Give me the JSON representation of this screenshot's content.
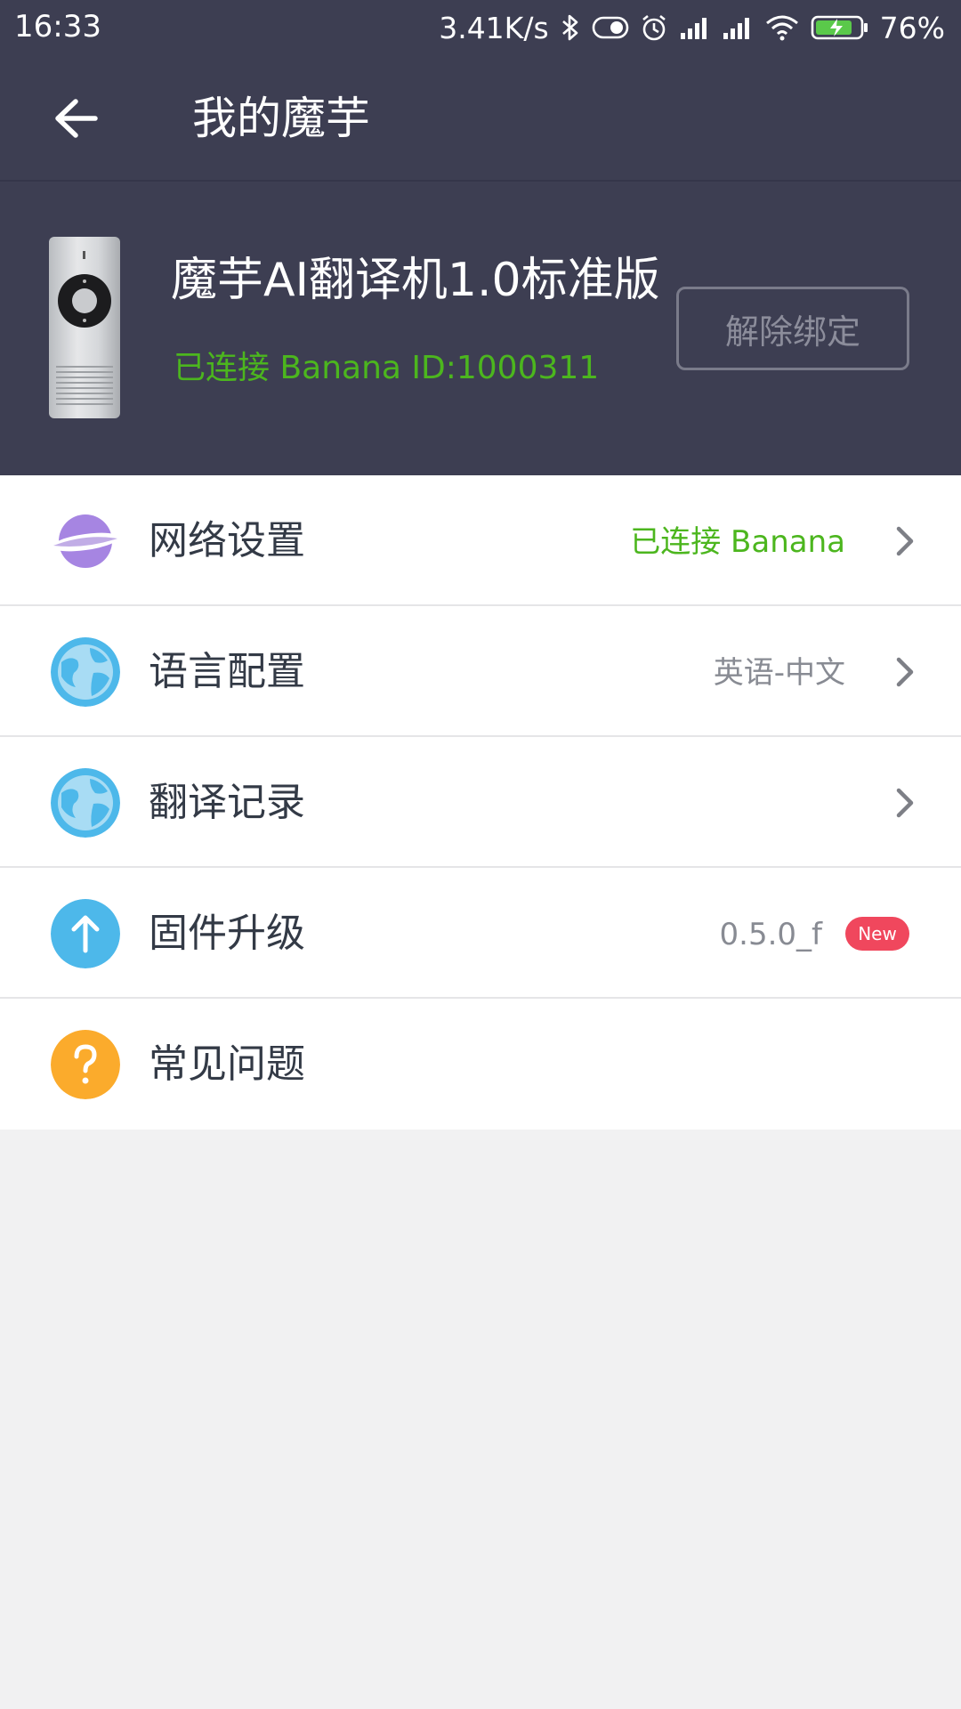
{
  "status_bar": {
    "time": "16:33",
    "net_speed": "3.41K/s",
    "battery": "76%",
    "icons": [
      "bluetooth-icon",
      "toggle-icon",
      "alarm-icon",
      "signal-icon",
      "signal-icon",
      "wifi-icon",
      "battery-charging-icon"
    ]
  },
  "app_bar": {
    "title": "我的魔芋"
  },
  "device": {
    "name": "魔芋AI翻译机1.0标准版",
    "status": "已连接 Banana ID:1000311",
    "unbind_label": "解除绑定"
  },
  "menu": {
    "items": [
      {
        "label": "网络设置",
        "value": "已连接 Banana",
        "icon": "planet-icon"
      },
      {
        "label": "语言配置",
        "value": "英语-中文",
        "icon": "globe-icon"
      },
      {
        "label": "翻译记录",
        "value": "",
        "icon": "globe-icon"
      },
      {
        "label": "固件升级",
        "value": "0.5.0_f",
        "badge": "New",
        "icon": "upload-arrow-icon"
      },
      {
        "label": "常见问题",
        "value": "",
        "icon": "question-icon"
      }
    ]
  },
  "colors": {
    "header_bg": "#3d3e52",
    "accent_green": "#4cb61e",
    "badge_red": "#f0475d",
    "page_bg": "#f1f1f2"
  }
}
